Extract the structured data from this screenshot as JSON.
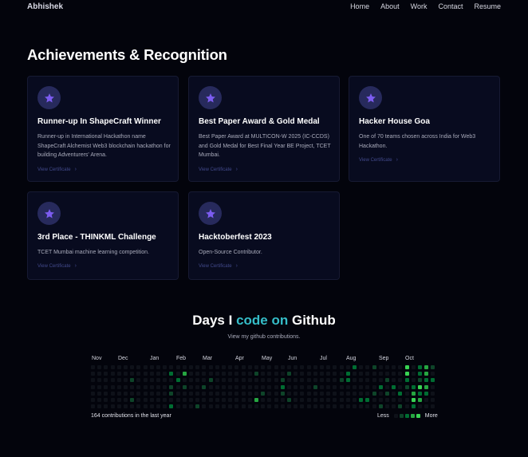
{
  "nav": {
    "brand": "Abhishek",
    "links": [
      "Home",
      "About",
      "Work",
      "Contact",
      "Resume"
    ]
  },
  "achievements": {
    "title": "Achievements & Recognition",
    "cards": [
      {
        "title": "Runner-up In ShapeCraft Winner",
        "description": "Runner-up in International Hackathon name ShapeCraft Alchemist Web3 blockchain hackathon for building Adventurers' Arena.",
        "link": "View Certificate"
      },
      {
        "title": "Best Paper Award & Gold Medal",
        "description": "Best Paper Award at MULTICON-W 2025 (IC-CCDS) and Gold Medal for Best Final Year BE Project, TCET Mumbai.",
        "link": "View Certificate"
      },
      {
        "title": "Hacker House Goa",
        "description": "One of 70 teams chosen across India for Web3 Hackathon.",
        "link": "View Certificate"
      },
      {
        "title": "3rd Place - THINKML Challenge",
        "description": "TCET Mumbai machine learning competition.",
        "link": "View Certificate"
      },
      {
        "title": "Hacktoberfest 2023",
        "description": "Open-Source Contributor.",
        "link": "View Certificate"
      }
    ]
  },
  "github": {
    "title_prefix": "Days I",
    "title_accent": "code on",
    "title_suffix": "Github",
    "subtitle": "View my github contributions.",
    "months": [
      "Nov",
      "Dec",
      "Jan",
      "Feb",
      "Mar",
      "Apr",
      "May",
      "Jun",
      "Jul",
      "Aug",
      "Sep",
      "Oct"
    ],
    "contributions_text": "164 contributions in the last year",
    "legend_less": "Less",
    "legend_more": "More",
    "colors": {
      "empty": "#0e1119",
      "level1": "#0e4429",
      "level2": "#006d32",
      "level3": "#26a641",
      "level4": "#39d353"
    }
  },
  "colors": {
    "background": "#03040c",
    "card": "#080b1f",
    "icon_bg": "#272a5c",
    "star": "#7c5cf0",
    "accent": "#35bdc8"
  }
}
